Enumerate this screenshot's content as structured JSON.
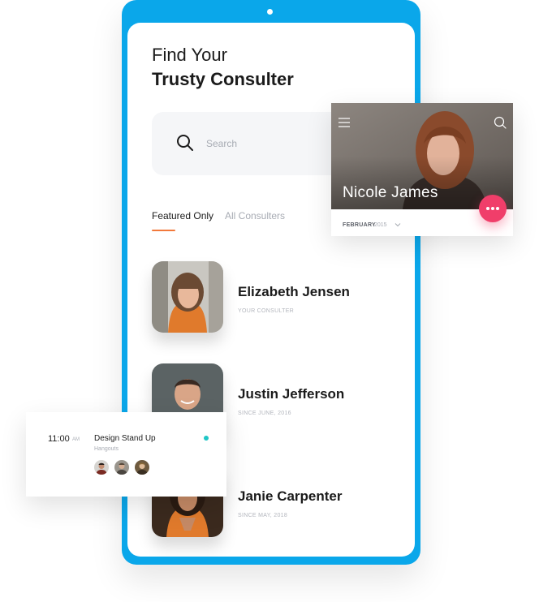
{
  "header": {
    "title_line1": "Find Your",
    "title_line2": "Trusty Consulter"
  },
  "search": {
    "placeholder": "Search"
  },
  "tabs": [
    {
      "label": "Featured Only",
      "active": true
    },
    {
      "label": "All Consulters",
      "active": false
    }
  ],
  "consultants": [
    {
      "name": "Elizabeth Jensen",
      "subtitle": "YOUR CONSULTER"
    },
    {
      "name": "Justin Jefferson",
      "subtitle": "SINCE JUNE, 2016"
    },
    {
      "name": "Janie Carpenter",
      "subtitle": "SINCE MAY, 2018"
    }
  ],
  "profile_card": {
    "name": "Nicole James",
    "month": "FEBRUARY",
    "year": "2015",
    "icons": [
      "hamburger-icon",
      "search-icon",
      "more-icon",
      "chevron-down-icon"
    ]
  },
  "meeting": {
    "time": "11:00",
    "ampm": "AM",
    "title": "Design Stand Up",
    "location": "Hangouts",
    "status_color": "#1fc6c6"
  },
  "colors": {
    "accent": "#0aa7ea",
    "tab_underline": "#f2793b",
    "more_button": "#f03e6a"
  }
}
